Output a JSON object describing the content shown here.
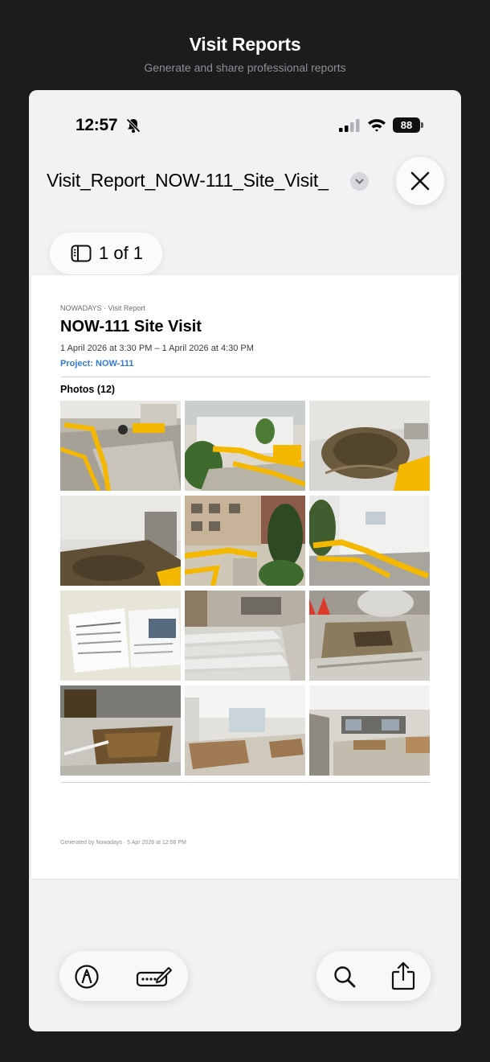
{
  "header": {
    "title": "Visit Reports",
    "subtitle": "Generate and share professional reports"
  },
  "status_bar": {
    "time": "12:57",
    "battery": "88"
  },
  "viewer": {
    "document_title": "Visit_Report_NOW-111_Site_Visit_",
    "page_indicator": "1 of 1"
  },
  "report": {
    "eyebrow": "NOWADAYS · Visit Report",
    "title": "NOW-111 Site Visit",
    "dates": "1 April 2026 at 3:30 PM – 1 April 2026 at 4:30 PM",
    "project": "Project: NOW-111",
    "photos_heading": "Photos (12)",
    "footer": "Generated by Nowadays · 5 Apr 2026 at 12:56 PM",
    "photos": [
      {
        "name": "photo-1",
        "scene": "paved-yard-barriers"
      },
      {
        "name": "photo-2",
        "scene": "garden-barriers"
      },
      {
        "name": "photo-3",
        "scene": "excavation-corner"
      },
      {
        "name": "photo-4",
        "scene": "excavation-wall"
      },
      {
        "name": "photo-5",
        "scene": "building-yard"
      },
      {
        "name": "photo-6",
        "scene": "white-wall-barriers"
      },
      {
        "name": "photo-7",
        "scene": "notice-board"
      },
      {
        "name": "photo-8",
        "scene": "concrete-steps"
      },
      {
        "name": "photo-9",
        "scene": "steps-cones"
      },
      {
        "name": "photo-10",
        "scene": "pit-closeup"
      },
      {
        "name": "photo-11",
        "scene": "interior-hall"
      },
      {
        "name": "photo-12",
        "scene": "interior-room"
      }
    ]
  },
  "toolbar": {
    "left": [
      "markup-icon",
      "autofill-icon"
    ],
    "right": [
      "search-icon",
      "share-icon"
    ]
  },
  "colors": {
    "background": "#1c1c1e",
    "panel": "#f2f2f4",
    "link": "#2f7bd8",
    "barrier_yellow": "#f5b800"
  }
}
